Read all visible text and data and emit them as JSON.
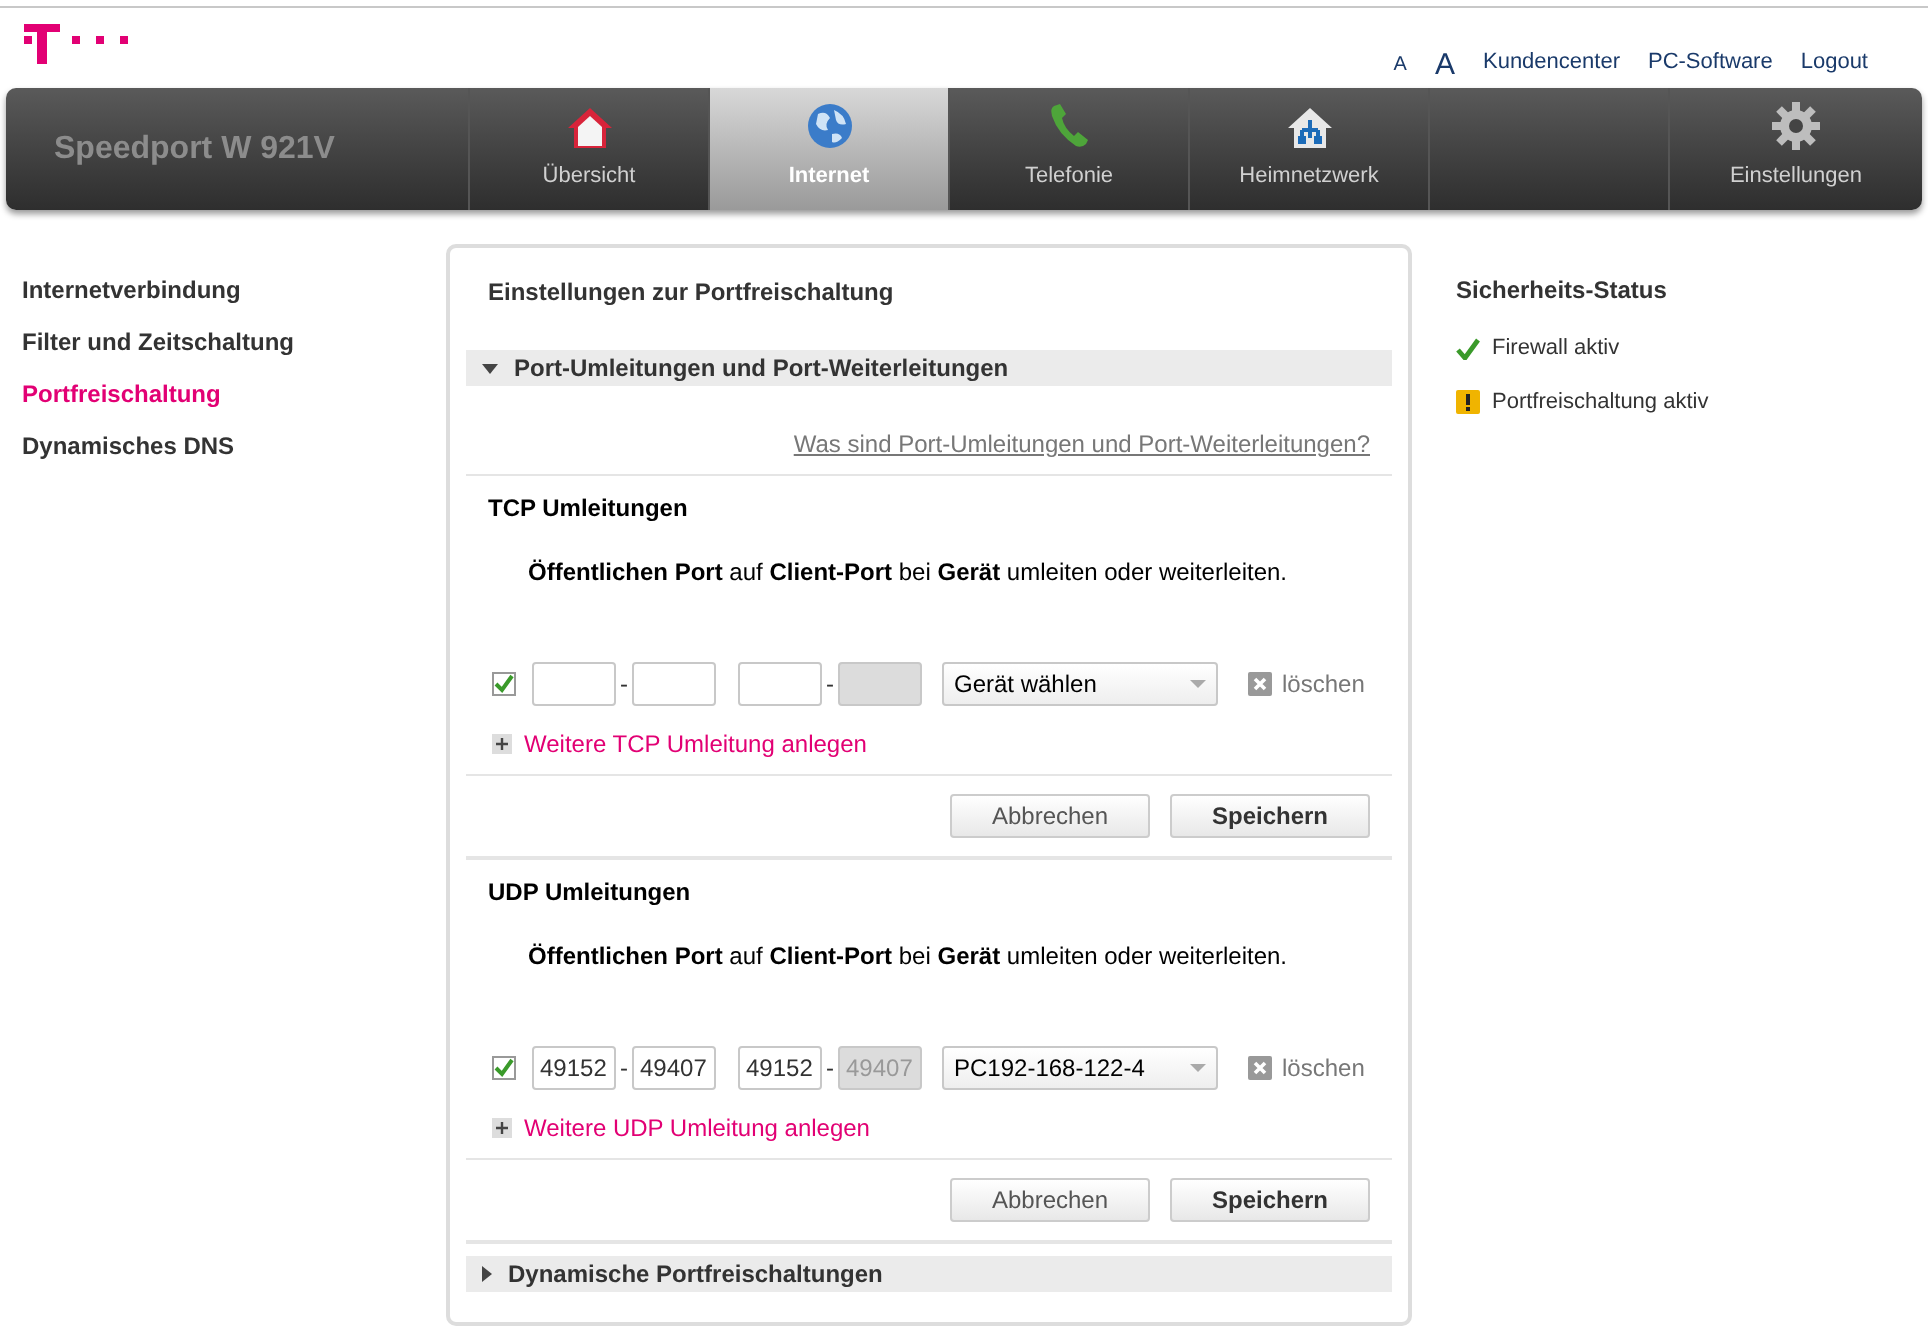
{
  "header": {
    "links": [
      {
        "label": "A",
        "kind": "font-small"
      },
      {
        "label": "A",
        "kind": "font-large"
      },
      {
        "label": "Kundencenter",
        "kind": "link"
      },
      {
        "label": "PC-Software",
        "kind": "link"
      },
      {
        "label": "Logout",
        "kind": "link"
      }
    ]
  },
  "nav": {
    "brand": "Speedport W 921V",
    "tabs": [
      {
        "label": "Übersicht",
        "selected": false
      },
      {
        "label": "Internet",
        "selected": true
      },
      {
        "label": "Telefonie",
        "selected": false
      },
      {
        "label": "Heimnetzwerk",
        "selected": false
      },
      {
        "label": "Einstellungen",
        "selected": false
      }
    ]
  },
  "sidebar": {
    "items": [
      {
        "label": "Internetverbindung",
        "selected": false
      },
      {
        "label": "Filter und Zeitschaltung",
        "selected": false
      },
      {
        "label": "Portfreischaltung",
        "selected": true
      },
      {
        "label": "Dynamisches DNS",
        "selected": false
      }
    ]
  },
  "panel": {
    "title": "Einstellungen zur Portfreischaltung",
    "groups": [
      {
        "title": "Port-Umleitungen und Port-Weiterleitungen",
        "expanded": true,
        "help_link": "Was sind Port-Umleitungen und Port-Weiterleitungen?",
        "sections": [
          {
            "title": "TCP Umleitungen",
            "description": "**Öffentlichen Port** auf **Client-Port** bei **Gerät** umleiten oder weiterleiten.",
            "rules": [
              {
                "checked": true,
                "ports": [
                  {
                    "disabled": false
                  },
                  {
                    "disabled": false
                  },
                  {
                    "disabled": false
                  },
                  {
                    "disabled": true
                  }
                ],
                "separators": [
                  "-",
                  "-"
                ],
                "device": "Gerät wählen",
                "delete": "löschen"
              }
            ],
            "add": "Weitere TCP Umleitung anlegen",
            "buttons": [
              "Abbrechen",
              "Speichern"
            ]
          },
          {
            "title": "UDP Umleitungen",
            "description": "**Öffentlichen Port** auf **Client-Port** bei **Gerät** umleiten oder weiterleiten.",
            "rules": [
              {
                "checked": true,
                "ports": [
                  {
                    "value": "49152",
                    "disabled": false
                  },
                  {
                    "value": "49407",
                    "disabled": false
                  },
                  {
                    "value": "49152",
                    "disabled": false
                  },
                  {
                    "value": "49407",
                    "disabled": true
                  }
                ],
                "separators": [
                  "-",
                  "-"
                ],
                "device": "PC192-168-122-4",
                "delete": "löschen"
              }
            ],
            "add": "Weitere UDP Umleitung anlegen",
            "buttons": [
              "Abbrechen",
              "Speichern"
            ]
          }
        ]
      },
      {
        "title": "Dynamische Portfreischaltungen",
        "expanded": false
      }
    ]
  },
  "security": {
    "title": "Sicherheits-Status",
    "items": [
      {
        "label": "Firewall aktiv",
        "kind": "ok"
      },
      {
        "label": "Portfreischaltung aktiv",
        "kind": "warning"
      }
    ]
  }
}
